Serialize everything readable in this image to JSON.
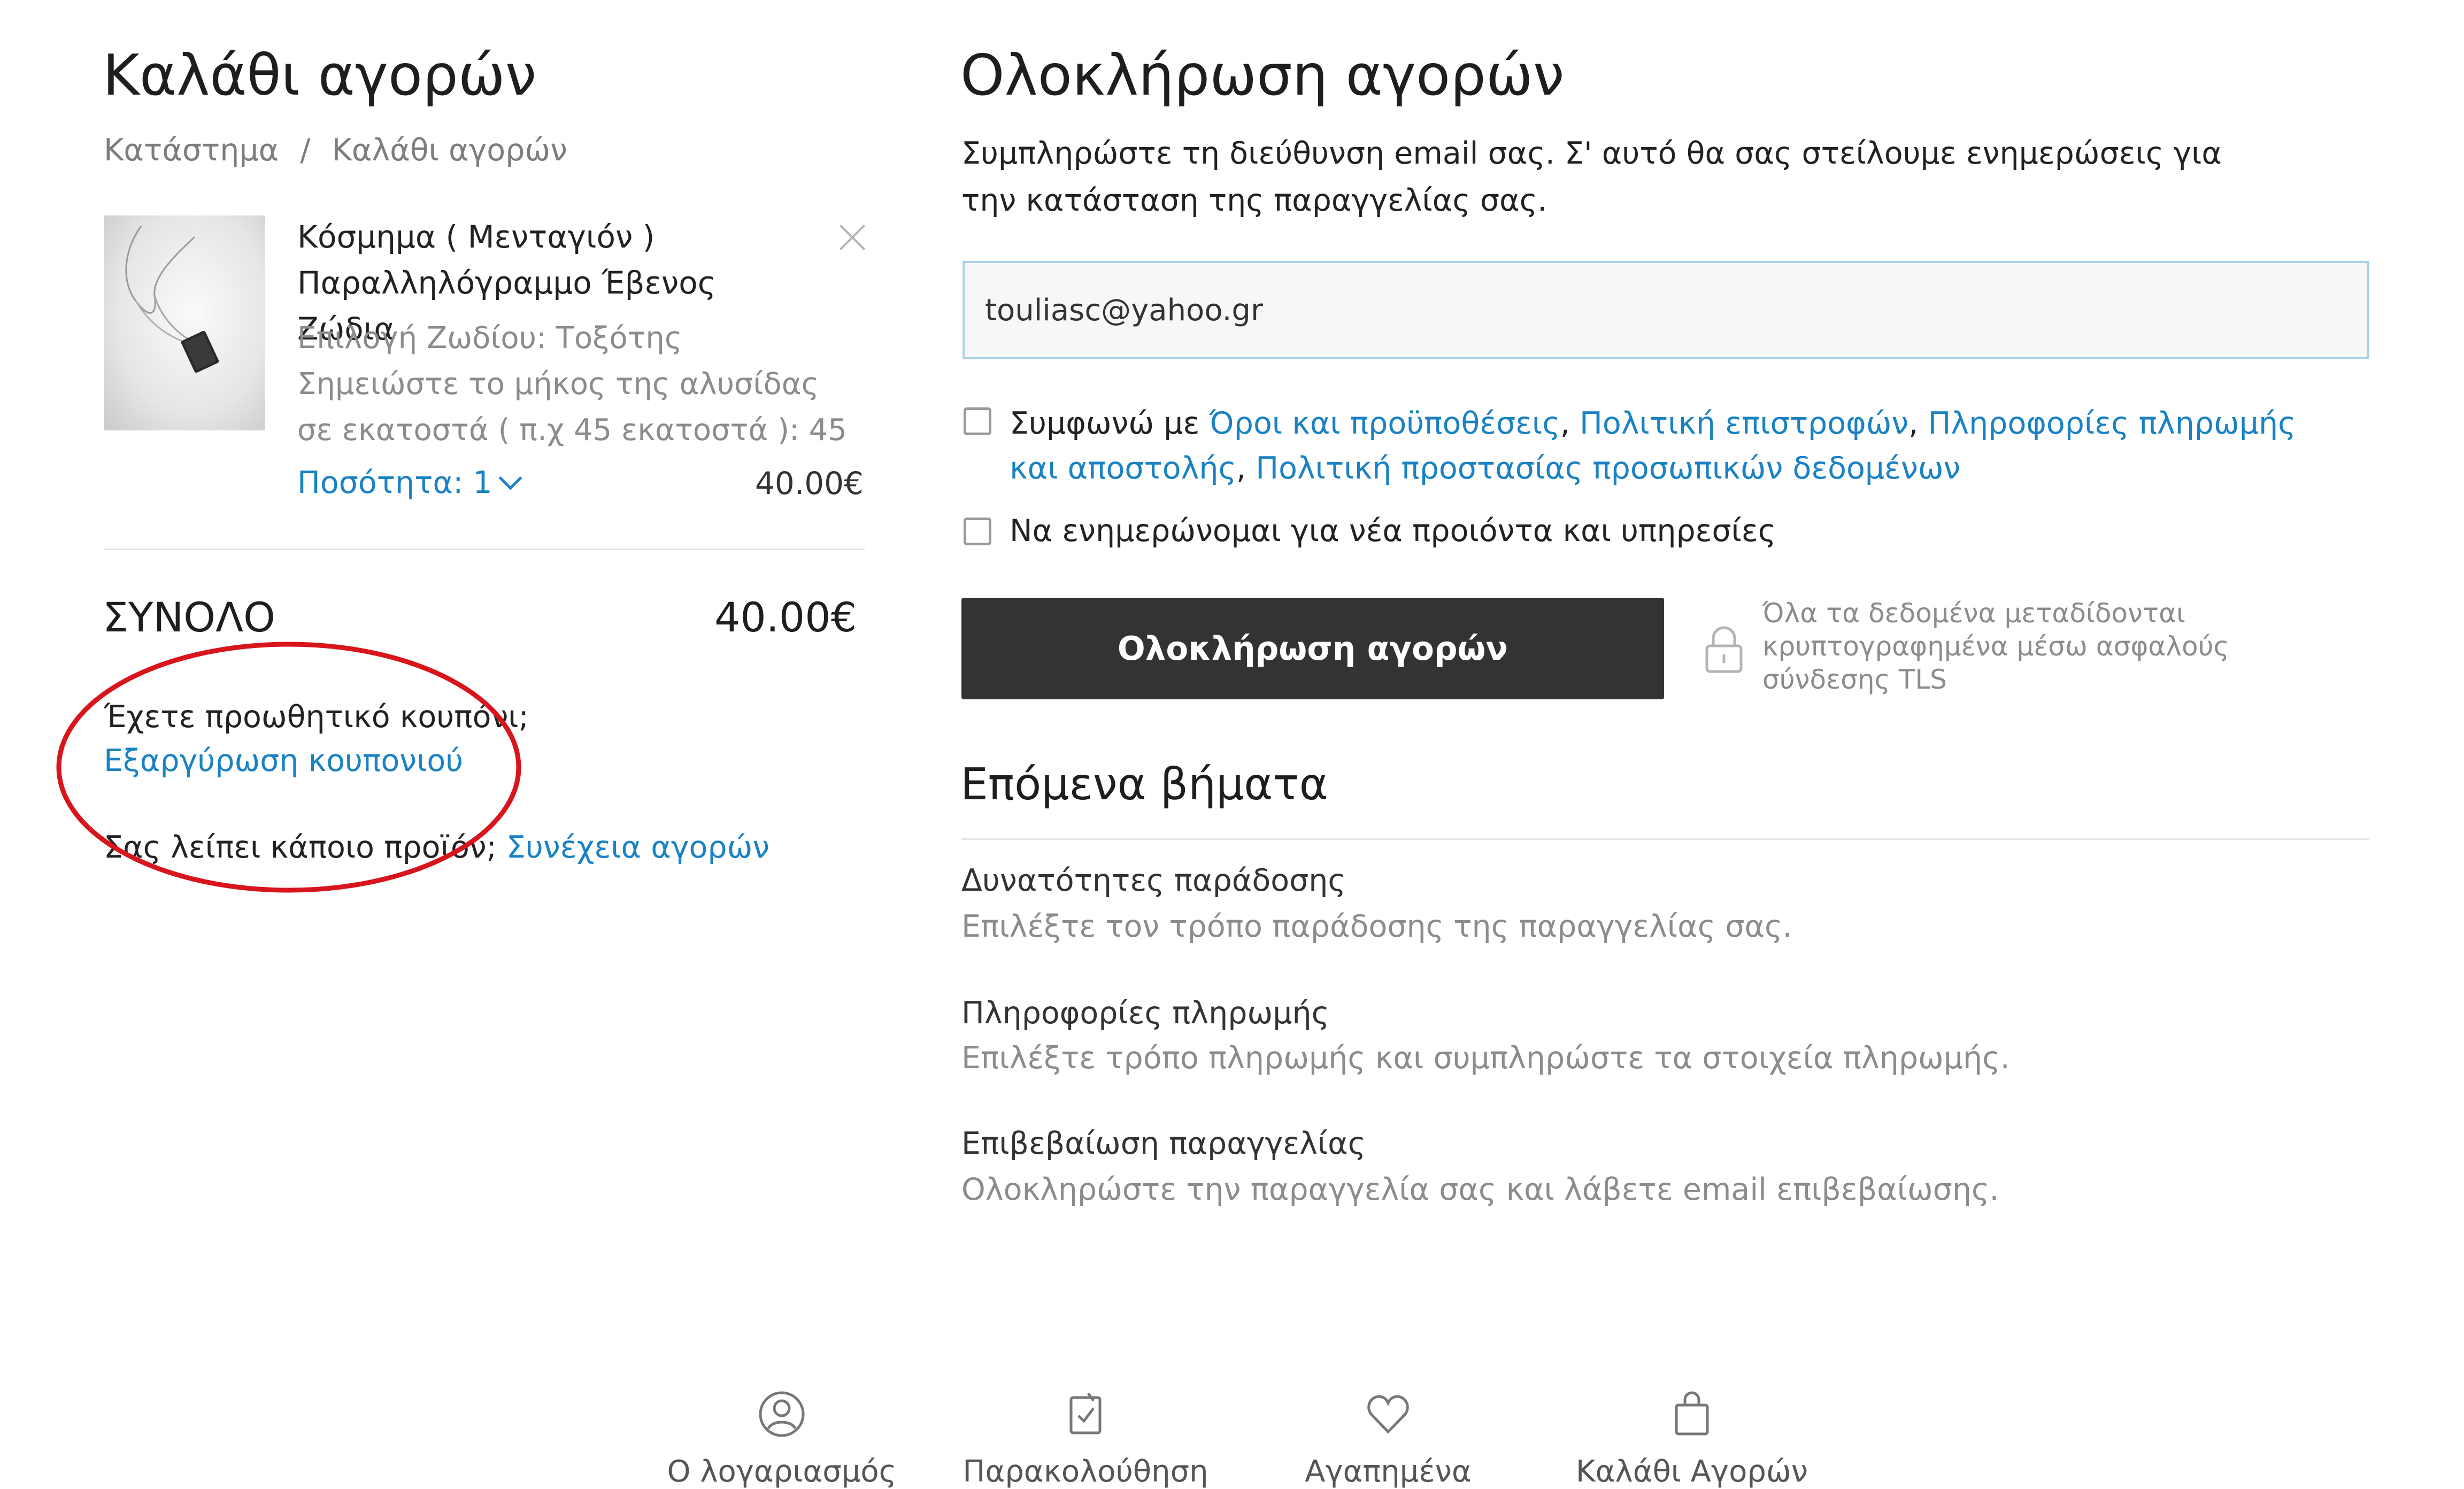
{
  "cart": {
    "title": "Καλάθι αγορών",
    "breadcrumb": [
      "Κατάστημα",
      "/",
      "Καλάθι αγορών"
    ],
    "item": {
      "title_line1": "Κόσμημα ( Μενταγιόν )",
      "title_line2": "Παραλληλόγραμμο Έβενος Ζώδια",
      "option1": "Επιλογή Ζωδίου: Τοξότης",
      "option2": "Σημειώστε το μήκος της αλυσίδας σε εκατοστά ( π.χ 45 εκατοστά ): 45",
      "quantity_label": "Ποσότητα: 1",
      "price": "40.00€"
    },
    "total_label": "ΣΥΝΟΛΟ",
    "total_value": "40.00€",
    "coupon_question": "Έχετε προωθητικό κουπόνι;",
    "coupon_link": "Εξαργύρωση κουπονιού",
    "missing_text": "Σας λείπει κάποιο προϊόν;",
    "continue_link": "Συνέχεια αγορών"
  },
  "checkout": {
    "title": "Ολοκλήρωση αγορών",
    "description": "Συμπληρώστε τη διεύθυνση email σας. Σ' αυτό θα σας στείλουμε ενημερώσεις για την κατάσταση της παραγγελίας σας.",
    "email_value": "touliasc@yahoo.gr",
    "terms": {
      "prefix": "Συμφωνώ με ",
      "link1": "Όροι και προϋποθέσεις",
      "sep": ", ",
      "link2": "Πολιτική επιστροφών",
      "link3": "Πληροφορίες πληρωμής και αποστολής",
      "link4": "Πολιτική προστασίας προσωπικών δεδομένων"
    },
    "newsletter": "Να ενημερώνομαι για νέα προιόντα και υπηρεσίες",
    "button": "Ολοκλήρωση αγορών",
    "secure_note": "Όλα τα δεδομένα μεταδίδονται κρυπτογραφημένα μέσω ασφαλούς σύνδεσης TLS",
    "next_title": "Επόμενα βήματα",
    "steps": [
      {
        "title": "Δυνατότητες παράδοσης",
        "desc": "Επιλέξτε τον τρόπο παράδοσης της παραγγελίας σας."
      },
      {
        "title": "Πληροφορίες πληρωμής",
        "desc": "Επιλέξτε τρόπο πληρωμής και συμπληρώστε τα στοιχεία πληρωμής."
      },
      {
        "title": "Επιβεβαίωση παραγγελίας",
        "desc": "Ολοκληρώστε την παραγγελία σας και λάβετε email επιβεβαίωσης."
      }
    ]
  },
  "bottom_nav": [
    {
      "label": "Ο λογαριασμός",
      "icon": "user-icon"
    },
    {
      "label": "Παρακολούθηση",
      "icon": "tracking-icon"
    },
    {
      "label": "Αγαπημένα",
      "icon": "heart-icon"
    },
    {
      "label": "Καλάθι Αγορών",
      "icon": "bag-icon"
    }
  ],
  "colors": {
    "link": "#1a82c4",
    "button_bg": "#333333",
    "annotation": "#d8141c"
  }
}
